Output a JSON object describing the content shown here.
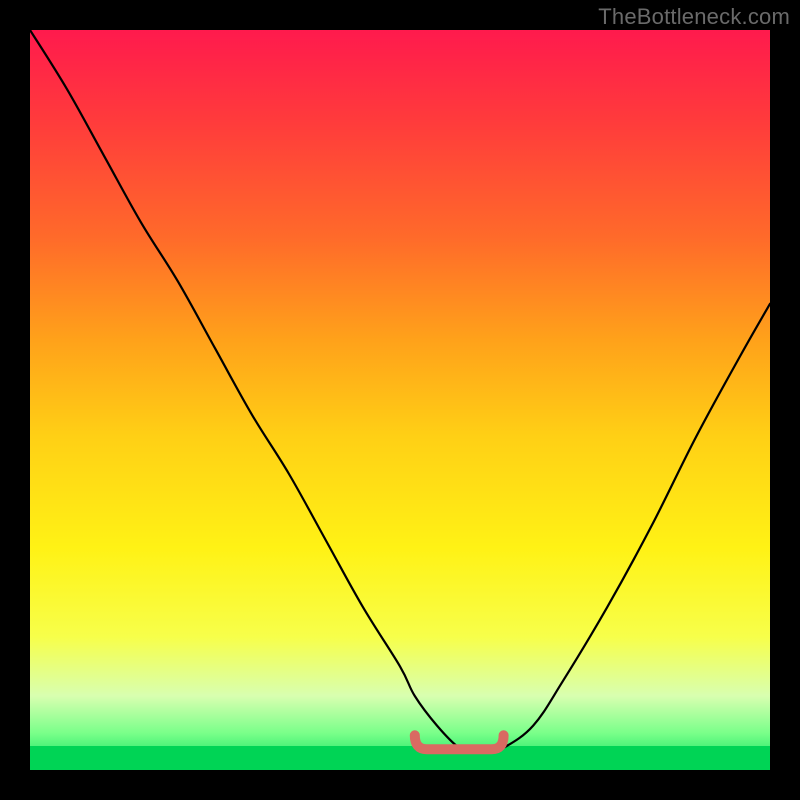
{
  "watermark": "TheBottleneck.com",
  "colors": {
    "background": "#000000",
    "gradient_top": "#ff1a4d",
    "gradient_bottom": "#00e05a",
    "curve_stroke": "#000000",
    "marker_stroke": "#d96a62"
  },
  "chart_data": {
    "type": "line",
    "title": "",
    "xlabel": "",
    "ylabel": "",
    "xlim": [
      0,
      100
    ],
    "ylim": [
      0,
      100
    ],
    "grid": false,
    "series": [
      {
        "name": "bottleneck-curve",
        "x": [
          0,
          5,
          10,
          15,
          20,
          25,
          30,
          35,
          40,
          45,
          50,
          52,
          55,
          58,
          60,
          62,
          64,
          68,
          72,
          78,
          84,
          90,
          96,
          100
        ],
        "y": [
          100,
          92,
          83,
          74,
          66,
          57,
          48,
          40,
          31,
          22,
          14,
          10,
          6,
          3,
          2.5,
          2.5,
          3,
          6,
          12,
          22,
          33,
          45,
          56,
          63
        ]
      }
    ],
    "annotations": {
      "optimal_range_x": [
        52,
        64
      ],
      "optimal_range_y": 2.8
    }
  }
}
